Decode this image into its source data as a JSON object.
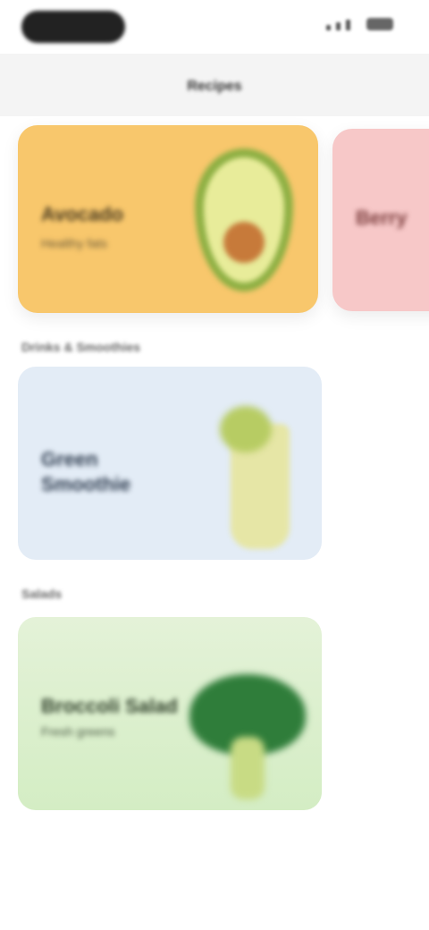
{
  "status_bar": {
    "signal_bars": 3
  },
  "header": {
    "title": "Recipes"
  },
  "carousel": {
    "featured": {
      "title": "Avocado",
      "subtitle": "Healthy fats"
    },
    "next": {
      "title": "Berry"
    }
  },
  "sections": [
    {
      "title": "Drinks & Smoothies",
      "card": {
        "title": "Green\nSmoothie"
      }
    },
    {
      "title": "Salads",
      "card": {
        "title": "Broccoli Salad",
        "subtitle": "Fresh greens"
      }
    }
  ],
  "colors": {
    "featured_card": "#f8c76c",
    "peek_card": "#f7c8c8",
    "smoothie_card": "#e3ecf6",
    "salad_card": "#d4edc4"
  }
}
